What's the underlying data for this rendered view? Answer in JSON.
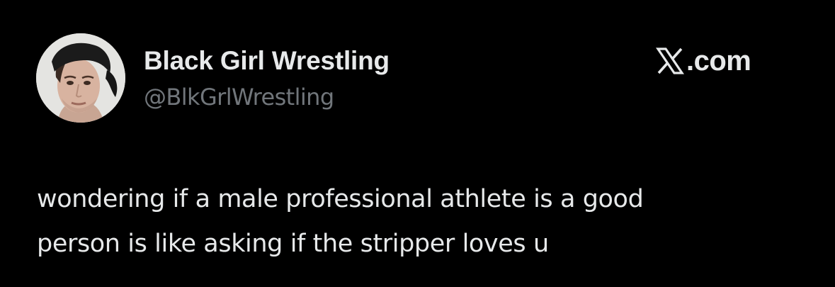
{
  "author": {
    "display_name": "Black Girl Wrestling",
    "handle": "@BlkGrlWrestling",
    "avatar_icon": "profile-photo"
  },
  "brand": {
    "logo_icon": "x-logo-icon",
    "text": ".com"
  },
  "tweet": {
    "lines": [
      "wondering if a male professional athlete is a good",
      "person is like asking if the stripper loves u"
    ]
  },
  "colors": {
    "background": "#000000",
    "primary_text": "#e7e9ea",
    "secondary_text": "#71767b"
  }
}
